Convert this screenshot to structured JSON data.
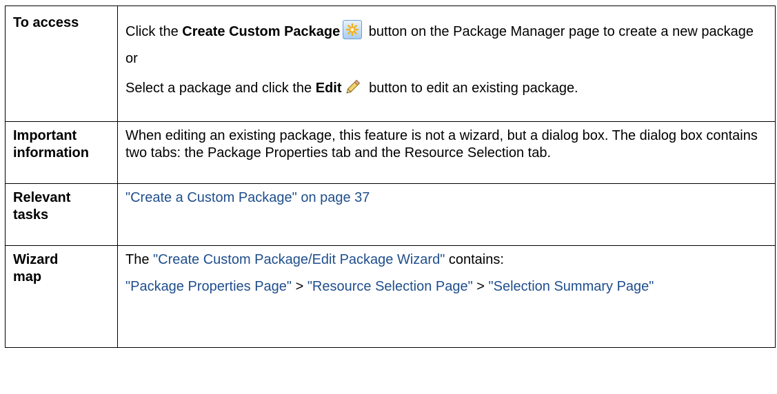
{
  "rows": {
    "access": {
      "label": "To access",
      "line1_pre": "Click the ",
      "line1_bold": "Create Custom Package",
      "line1_post": " button on the Package Manager page to create a new package",
      "or": "or",
      "line2_pre": "Select a package and click the ",
      "line2_bold": "Edit",
      "line2_post": " button to edit an existing package.",
      "create_icon": "create-package-icon",
      "edit_icon": "pencil-icon"
    },
    "important": {
      "label_line1": "Important",
      "label_line2": "information",
      "text": "When editing an existing package, this feature is not a wizard, but a dialog box. The dialog box contains two tabs: the Package Properties tab and the Resource Selection tab."
    },
    "tasks": {
      "label_line1": "Relevant",
      "label_line2": "tasks",
      "link": "\"Create a Custom Package\" on page 37"
    },
    "map": {
      "label_line1": "Wizard",
      "label_line2": "map",
      "intro_pre": "The ",
      "intro_link": "\"Create Custom Package/Edit Package Wizard\"",
      "intro_post": " contains:",
      "step1": "\"Package Properties Page\"",
      "sep1": " > ",
      "step2": "\"Resource Selection Page\"",
      "sep2": " > ",
      "step3": "\"Selection Summary Page\""
    }
  },
  "colors": {
    "link": "#1f4e8c",
    "border": "#000000"
  }
}
